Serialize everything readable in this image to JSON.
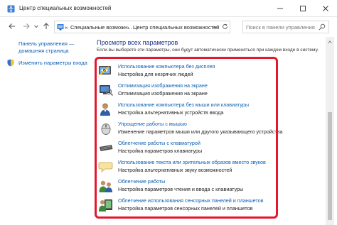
{
  "window": {
    "title": "Центр специальных возможностей"
  },
  "address": {
    "root": "«",
    "segment1": "Специальные возможн...",
    "separator": "›",
    "segment2": "Центр специальных возможностей"
  },
  "search": {
    "placeholder": "Поиск в панели управления"
  },
  "sidebar": {
    "home_line1": "Панель управления —",
    "home_line2": "домашняя страница",
    "signin": "Изменить параметры входа"
  },
  "main": {
    "title": "Просмотр всех параметров",
    "intro": "Если вы выберете эти параметры, они будут автоматически применяться при каждом входе в систему.",
    "items": [
      {
        "link": "Использование компьютера без дисплея",
        "desc": "Настройка для незрячих людей",
        "icon": "narrator-icon"
      },
      {
        "link": "Оптимизация изображения на экране",
        "desc": "Оптимизация изображения на экране",
        "icon": "display-icon"
      },
      {
        "link": "Использование компьютера без мыши или клавиатуры",
        "desc": "Настройка альтернативных устройств ввода",
        "icon": "user-icon"
      },
      {
        "link": "Упрощение работы с мышью",
        "desc": "Изменение параметров мыши или другого указывающего устройства",
        "icon": "mouse-icon"
      },
      {
        "link": "Облегчение работы с клавиатурой",
        "desc": "Настройка параметров клавиатуры",
        "icon": "keyboard-icon"
      },
      {
        "link": "Использование текста или зрительных образов вместо звуков",
        "desc": "Настройка альтернативных звуку возможностей",
        "icon": "speech-bubble-icon"
      },
      {
        "link": "Облегчение работы",
        "desc": "Настройка параметров чтения и ввода с клавиатуры",
        "icon": "users-icon"
      },
      {
        "link": "Облегчение использования сенсорных панелей и планшетов",
        "desc": "Настройка параметров сенсорных панелей и планшетов",
        "icon": "touch-icon"
      }
    ]
  },
  "colors": {
    "link": "#0b5fb0",
    "heading": "#1e3287",
    "highlight": "#e3182d"
  }
}
